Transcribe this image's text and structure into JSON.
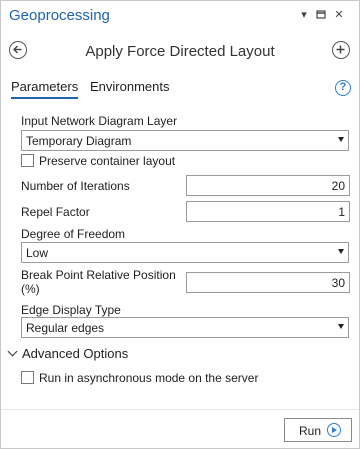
{
  "window": {
    "title": "Geoprocessing",
    "controls": [
      "dropdown-arrow-icon",
      "pin-icon",
      "close-icon"
    ]
  },
  "header": {
    "tool_title": "Apply Force Directed Layout",
    "back_icon": "back-arrow-icon",
    "add_icon": "add-icon"
  },
  "tabs": [
    {
      "label": "Parameters",
      "active": true
    },
    {
      "label": "Environments",
      "active": false
    }
  ],
  "help_icon": {
    "name": "help-icon",
    "glyph": "?"
  },
  "parameters": {
    "input_layer": {
      "label": "Input Network Diagram Layer",
      "value": "Temporary Diagram"
    },
    "preserve_container": {
      "label": "Preserve container layout",
      "checked": false
    },
    "iterations": {
      "label": "Number of Iterations",
      "value": "20"
    },
    "repel_factor": {
      "label": "Repel Factor",
      "value": "1"
    },
    "degree_of_freedom": {
      "label": "Degree of Freedom",
      "value": "Low"
    },
    "break_point": {
      "label_line1": "Break Point Relative Position",
      "label_line2": "(%)",
      "value": "30"
    },
    "edge_display_type": {
      "label": "Edge Display Type",
      "value": "Regular edges"
    }
  },
  "advanced": {
    "title": "Advanced Options",
    "async_label": "Run in asynchronous mode on the server",
    "async_checked": false
  },
  "footer": {
    "run_label": "Run",
    "run_icon": "play-icon"
  },
  "colors": {
    "accent": "#1e63ab",
    "help": "#2d7fd0"
  }
}
